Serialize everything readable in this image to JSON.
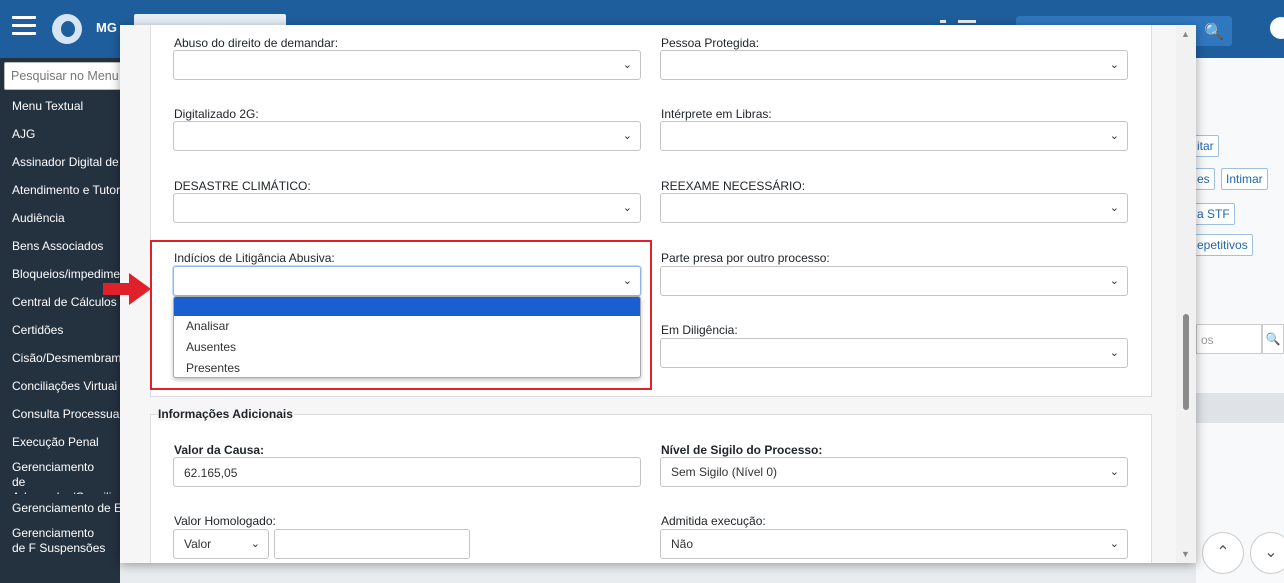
{
  "app": {
    "brand": "MG",
    "search_icon": "magnifier",
    "sidebar_search_placeholder": "Pesquisar no Menu"
  },
  "sidebar": {
    "items": [
      "Menu Textual",
      "AJG",
      "Assinador Digital de",
      "Atendimento e Tutor",
      "Audiência",
      "Bens Associados",
      "Bloqueios/impedime",
      "Central de Cálculos",
      "Certidões",
      "Cisão/Desmembram",
      "Conciliações Virtuai",
      "Consulta Processua",
      "Execução Penal",
      "Gerenciamento de Advogados/Concilia",
      "Gerenciamento de E",
      "Gerenciamento de F Suspensões"
    ]
  },
  "background_page": {
    "buttons": [
      "itar",
      "es",
      "Intimar",
      "a STF",
      "epetitivos"
    ],
    "search_fragment": "os",
    "search_button_icon": "magnifier"
  },
  "form": {
    "left": [
      {
        "label": "Abuso do direito de demandar:",
        "value": ""
      },
      {
        "label": "Digitalizado 2G:",
        "value": ""
      },
      {
        "label": "DESASTRE CLIMÁTICO:",
        "value": ""
      },
      {
        "label": "Indícios de Litigância Abusiva:",
        "value": ""
      }
    ],
    "right": [
      {
        "label": "Pessoa Protegida:",
        "value": ""
      },
      {
        "label": "Intérprete em Libras:",
        "value": ""
      },
      {
        "label": "REEXAME NECESSÁRIO:",
        "value": ""
      },
      {
        "label": "Parte presa por outro processo:",
        "value": ""
      },
      {
        "label": "Em Diligência:",
        "value": ""
      }
    ],
    "dropdown_options": [
      "",
      "Analisar",
      "Ausentes",
      "Presentes"
    ]
  },
  "additional": {
    "legend": "Informações Adicionais",
    "valor_causa_label": "Valor da Causa:",
    "valor_causa_value": "62.165,05",
    "nivel_sigilo_label": "Nível de Sigilo do Processo:",
    "nivel_sigilo_value": "Sem Sigilo (Nível 0)",
    "valor_homologado_label": "Valor Homologado:",
    "valor_homologado_select": "Valor",
    "admitida_execucao_label": "Admitida execução:",
    "admitida_execucao_value": "Não"
  },
  "colors": {
    "topbar": "#1f5e9c",
    "sidebar": "#24313f",
    "highlight": "#e0202a",
    "selected_option": "#1a5fd0"
  }
}
